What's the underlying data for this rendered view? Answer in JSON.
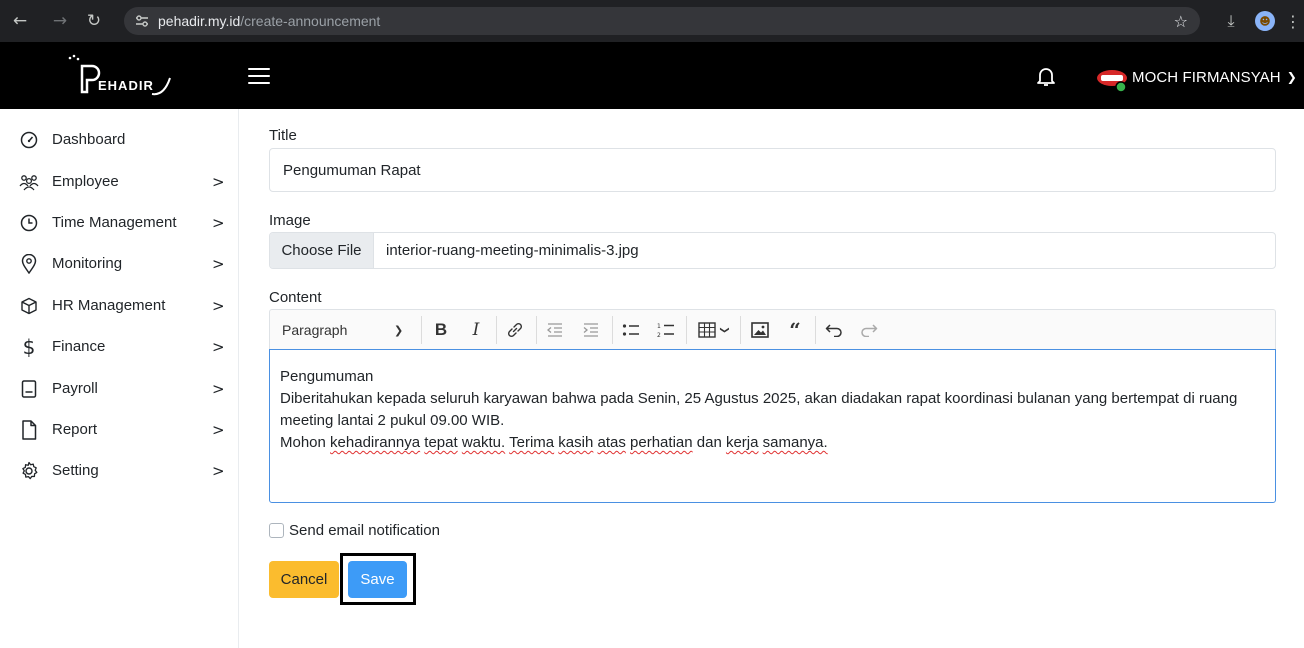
{
  "browser": {
    "url_host": "pehadir.my.id",
    "url_path": "/create-announcement"
  },
  "header": {
    "brand_name": "PEHADIR",
    "user_name": "MOCH FIRMANSYAH"
  },
  "sidebar": {
    "items": [
      {
        "label": "Dashboard",
        "icon": "dashboard-icon",
        "has_submenu": false
      },
      {
        "label": "Employee",
        "icon": "employee-icon",
        "has_submenu": true
      },
      {
        "label": "Time Management",
        "icon": "clock-icon",
        "has_submenu": true
      },
      {
        "label": "Monitoring",
        "icon": "location-pin-icon",
        "has_submenu": true
      },
      {
        "label": "HR Management",
        "icon": "cube-icon",
        "has_submenu": true
      },
      {
        "label": "Finance",
        "icon": "dollar-icon",
        "has_submenu": true
      },
      {
        "label": "Payroll",
        "icon": "calculator-icon",
        "has_submenu": true
      },
      {
        "label": "Report",
        "icon": "file-icon",
        "has_submenu": true
      },
      {
        "label": "Setting",
        "icon": "gear-icon",
        "has_submenu": true
      }
    ],
    "chevron": ">"
  },
  "form": {
    "title_label": "Title",
    "title_value": "Pengumuman Rapat",
    "image_label": "Image",
    "choose_file_label": "Choose File",
    "file_name": "interior-ruang-meeting-minimalis-3.jpg",
    "content_label": "Content",
    "paragraph_select": "Paragraph",
    "content": {
      "line1": "Pengumuman",
      "line2": "Diberitahukan kepada seluruh karyawan bahwa pada Senin, 25 Agustus 2025, akan diadakan rapat koordinasi bulanan yang bertempat di ruang meeting lantai 2 pukul 09.00 WIB.",
      "line3_words": [
        "Mohon",
        "kehadirannya",
        "tepat",
        "waktu.",
        "Terima",
        "kasih",
        "atas",
        "perhatian",
        "dan",
        "kerja",
        "samanya."
      ]
    },
    "email_notification_label": "Send email notification",
    "email_notification_checked": false,
    "cancel_label": "Cancel",
    "save_label": "Save"
  },
  "colors": {
    "cancel_bg": "#fbbc2e",
    "save_bg": "#3d9bf7",
    "header_bg": "#000000",
    "focus_border": "#4a90e2"
  }
}
